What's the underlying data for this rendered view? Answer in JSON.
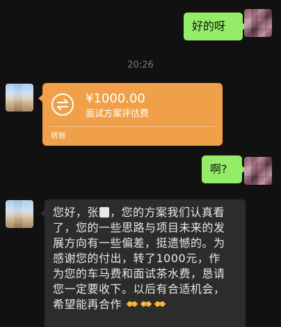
{
  "messages": {
    "msg1_text": "好的呀",
    "timestamp": "20:26",
    "transfer": {
      "amount": "¥1000.00",
      "note": "面试方案评估费",
      "type_label": "转账"
    },
    "msg2_text": "啊?",
    "msg3_lines": [
      "您好，张",
      "，您的方案我们认真看",
      "了，您的一些思路与项目未来的发",
      "展方向有一些偏差，挺遗憾的。为",
      "感谢您的付出，转了1000元，作",
      "为您的车马费和面试茶水费，恳请",
      "您一定要收下。以后有合适机会，",
      "希望能再合作"
    ]
  },
  "colors": {
    "background": "#111111",
    "bubble_self": "#95ec69",
    "bubble_other": "#2c2c2c",
    "transfer_card": "#f1a04a"
  },
  "icons": [
    "transfer-arrows-icon",
    "handshake-icon"
  ]
}
